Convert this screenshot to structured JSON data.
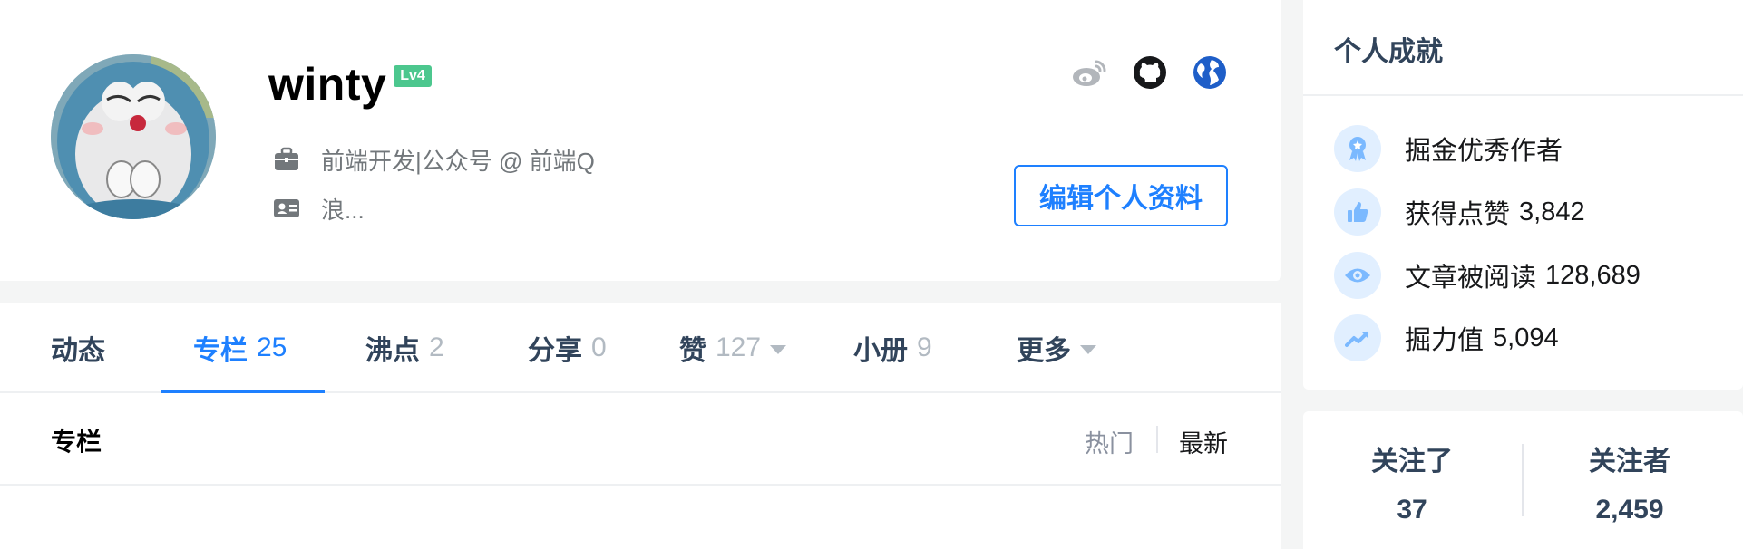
{
  "profile": {
    "username": "winty",
    "level_badge": "Lv4",
    "job": "前端开发|公众号 @ 前端Q",
    "intro": "浪...",
    "edit_label": "编辑个人资料",
    "social_icons": [
      "weibo-icon",
      "github-icon",
      "globe-icon"
    ]
  },
  "tabs": [
    {
      "label": "动态",
      "count": ""
    },
    {
      "label": "专栏",
      "count": "25"
    },
    {
      "label": "沸点",
      "count": "2"
    },
    {
      "label": "分享",
      "count": "0"
    },
    {
      "label": "赞",
      "count": "127"
    },
    {
      "label": "小册",
      "count": "9"
    },
    {
      "label": "更多",
      "count": ""
    }
  ],
  "active_tab": "专栏",
  "section": {
    "title": "专栏",
    "sort_hot": "热门",
    "sort_new": "最新"
  },
  "achievements": {
    "title": "个人成就",
    "items": [
      {
        "label": "掘金优秀作者",
        "value": "",
        "icon": "medal-icon"
      },
      {
        "label": "获得点赞",
        "value": "3,842",
        "icon": "thumbs-up-icon"
      },
      {
        "label": "文章被阅读",
        "value": "128,689",
        "icon": "eye-icon"
      },
      {
        "label": "掘力值",
        "value": "5,094",
        "icon": "trend-icon"
      }
    ]
  },
  "follow": {
    "following_label": "关注了",
    "following_count": "37",
    "followers_label": "关注者",
    "followers_count": "2,459"
  },
  "colors": {
    "accent": "#1e80ff",
    "level_green": "#4cc78e",
    "icon_bg": "#e1efff",
    "icon_fg": "#7bb9ff"
  }
}
